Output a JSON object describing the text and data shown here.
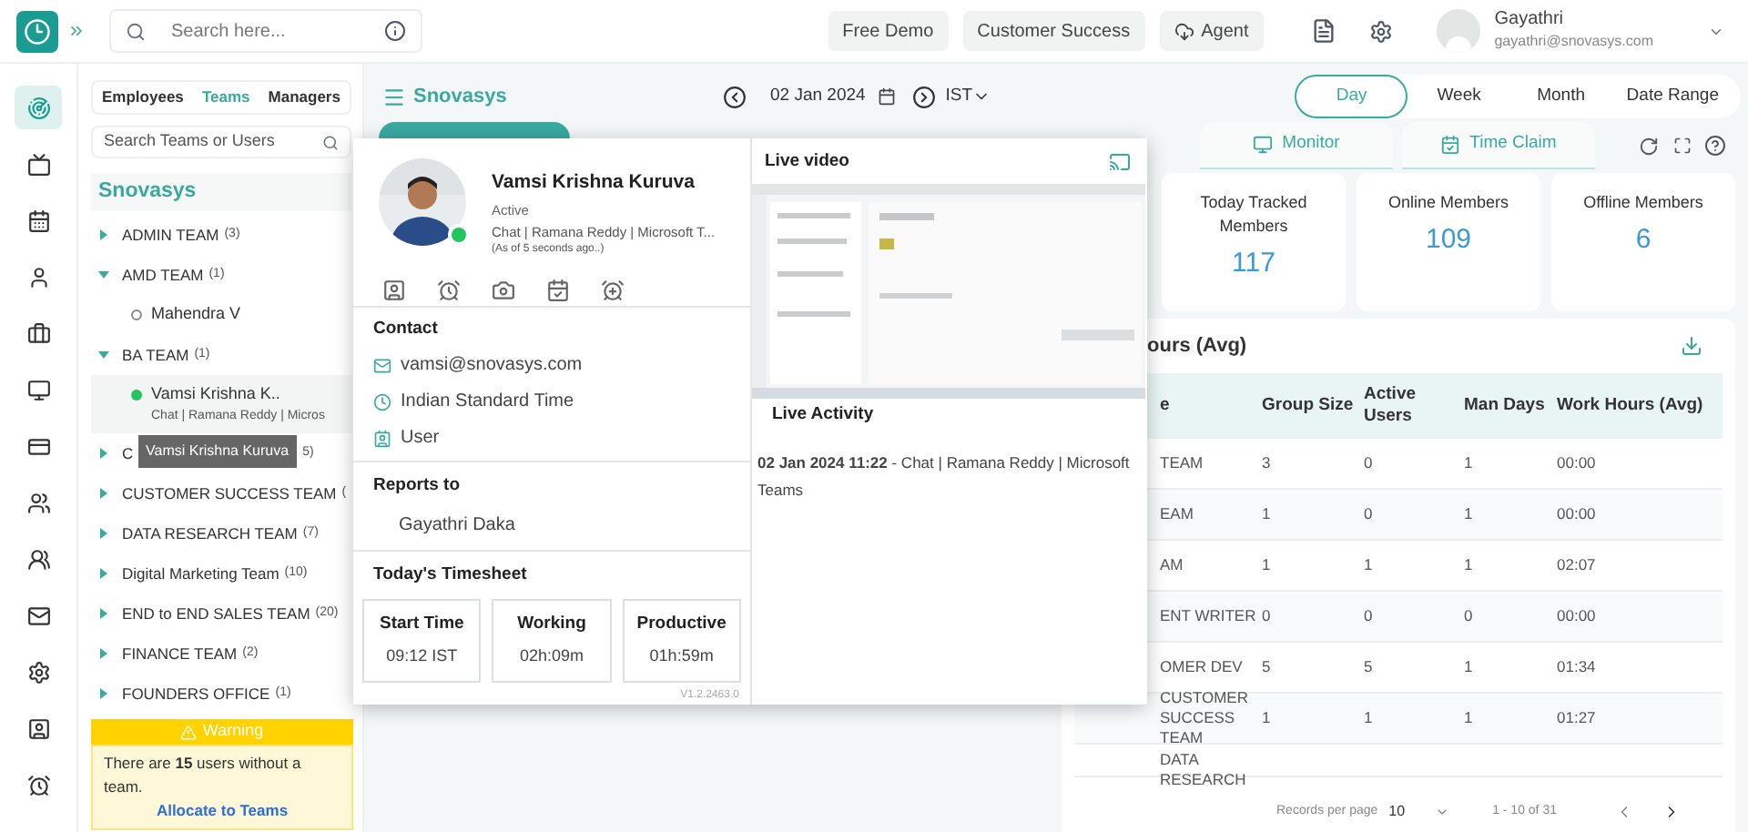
{
  "app_bar": {
    "search_placeholder": "Search here...",
    "buttons": [
      {
        "label": "Free Demo",
        "kind": "plain"
      },
      {
        "label": "Customer Success",
        "kind": "plain"
      },
      {
        "label": "Agent",
        "kind": "download"
      }
    ],
    "user": {
      "name": "Gayathri",
      "email": "gayathri@snovasys.com"
    }
  },
  "nav_rail": [
    {
      "selected": true
    },
    {
      "selected": false
    },
    {
      "selected": false
    },
    {
      "selected": false
    },
    {
      "selected": false
    },
    {
      "selected": false
    },
    {
      "selected": false
    },
    {
      "selected": false
    },
    {
      "selected": false
    },
    {
      "selected": false
    },
    {
      "selected": false
    },
    {
      "selected": false
    },
    {
      "selected": false
    }
  ],
  "sidebar": {
    "tabs": [
      {
        "label": "Employees",
        "selected": false
      },
      {
        "label": "Teams",
        "selected": true
      },
      {
        "label": "Managers",
        "selected": false
      }
    ],
    "search_placeholder": "Search Teams or Users",
    "organization": "Snovasys",
    "teams": [
      {
        "label": "ADMIN TEAM",
        "count": "(3)",
        "expanded": false
      },
      {
        "label": "AMD TEAM",
        "count": "(1)",
        "expanded": true,
        "children": [
          {
            "name": "Mahendra V",
            "online": false,
            "selected": false
          }
        ]
      },
      {
        "label": "BA TEAM",
        "count": "(1)",
        "expanded": true,
        "children": [
          {
            "name": "Vamsi Krishna K..",
            "online": true,
            "selected": true,
            "activity": "Chat | Ramana Reddy | Micros",
            "tooltip": "Vamsi Krishna Kuruva"
          }
        ]
      },
      {
        "label": "C",
        "count": "5)",
        "expanded": false,
        "under_tooltip": true
      },
      {
        "label": "CUSTOMER SUCCESS TEAM",
        "count": "(",
        "expanded": false
      },
      {
        "label": "DATA RESEARCH TEAM",
        "count": "(7)",
        "expanded": false
      },
      {
        "label": "Digital Marketing Team",
        "count": "(10)",
        "expanded": false
      },
      {
        "label": "END to END SALES TEAM",
        "count": "(20)",
        "expanded": false
      },
      {
        "label": "FINANCE TEAM",
        "count": "(2)",
        "expanded": false
      },
      {
        "label": "FOUNDERS OFFICE",
        "count": "(1)",
        "expanded": false
      }
    ],
    "warning": {
      "title": "Warning",
      "message": "There are **15** users without a team.",
      "link": "Allocate to Teams"
    }
  },
  "header": {
    "title": "Snovasys",
    "date": "02 Jan 2024",
    "timezone": "IST",
    "ranges": [
      {
        "label": "Day",
        "selected": true
      },
      {
        "label": "Week",
        "selected": false
      },
      {
        "label": "Month",
        "selected": false
      },
      {
        "label": "Date Range",
        "selected": false
      }
    ]
  },
  "view_tabs": [
    {
      "selected": true
    },
    {
      "label": "Monitor",
      "kind": "monitor",
      "selected": false
    },
    {
      "label": "Time Claim",
      "kind": "calendar",
      "selected": false
    }
  ],
  "stats": [
    {
      "label": "Today Tracked Members",
      "value": "117"
    },
    {
      "label": "Online Members",
      "value": "109"
    },
    {
      "label": "Offline Members",
      "value": "6"
    }
  ],
  "table": {
    "title": "ours (Avg)",
    "columns": [
      "e",
      "Group Size",
      "Active Users",
      "Man Days",
      "Work Hours (Avg)"
    ],
    "rows": [
      [
        "TEAM",
        "3",
        "0",
        "1",
        "00:00"
      ],
      [
        "EAM",
        "1",
        "0",
        "1",
        "00:00"
      ],
      [
        "AM",
        "1",
        "1",
        "1",
        "02:07"
      ],
      [
        "ENT WRITER",
        "0",
        "0",
        "0",
        "00:00"
      ],
      [
        "OMER DEV",
        "5",
        "5",
        "1",
        "01:34"
      ],
      [
        "CUSTOMER SUCCESS TEAM",
        "1",
        "1",
        "1",
        "01:27"
      ],
      [
        "DATA RESEARCH"
      ]
    ],
    "records_label": "Records per page",
    "per_page": "10",
    "range": "1 - 10 of 31"
  },
  "popup": {
    "name": "Vamsi Krishna Kuruva",
    "status": "Active",
    "online": true,
    "activity": "Chat | Ramana Reddy | Microsoft T...",
    "as_of": "(As of 5 seconds ago..)",
    "contact_title": "Contact",
    "contact": [
      {
        "kind": "email",
        "text": "vamsi@snovasys.com"
      },
      {
        "kind": "timezone",
        "text": "Indian Standard Time"
      },
      {
        "kind": "role",
        "text": "User"
      }
    ],
    "reports_title": "Reports to",
    "reports_to": "Gayathri Daka",
    "timesheet_title": "Today's Timesheet",
    "timesheet": [
      {
        "label": "Start Time",
        "value": "09:12 IST"
      },
      {
        "label": "Working",
        "value": "02h:09m"
      },
      {
        "label": "Productive",
        "value": "01h:59m"
      }
    ],
    "version": "V1.2.2463.0",
    "video_title": "Live video",
    "activity_title": "Live Activity",
    "activity_entry": "**02 Jan 2024 11:22** - Chat | Ramana Reddy | Microsoft Teams"
  }
}
